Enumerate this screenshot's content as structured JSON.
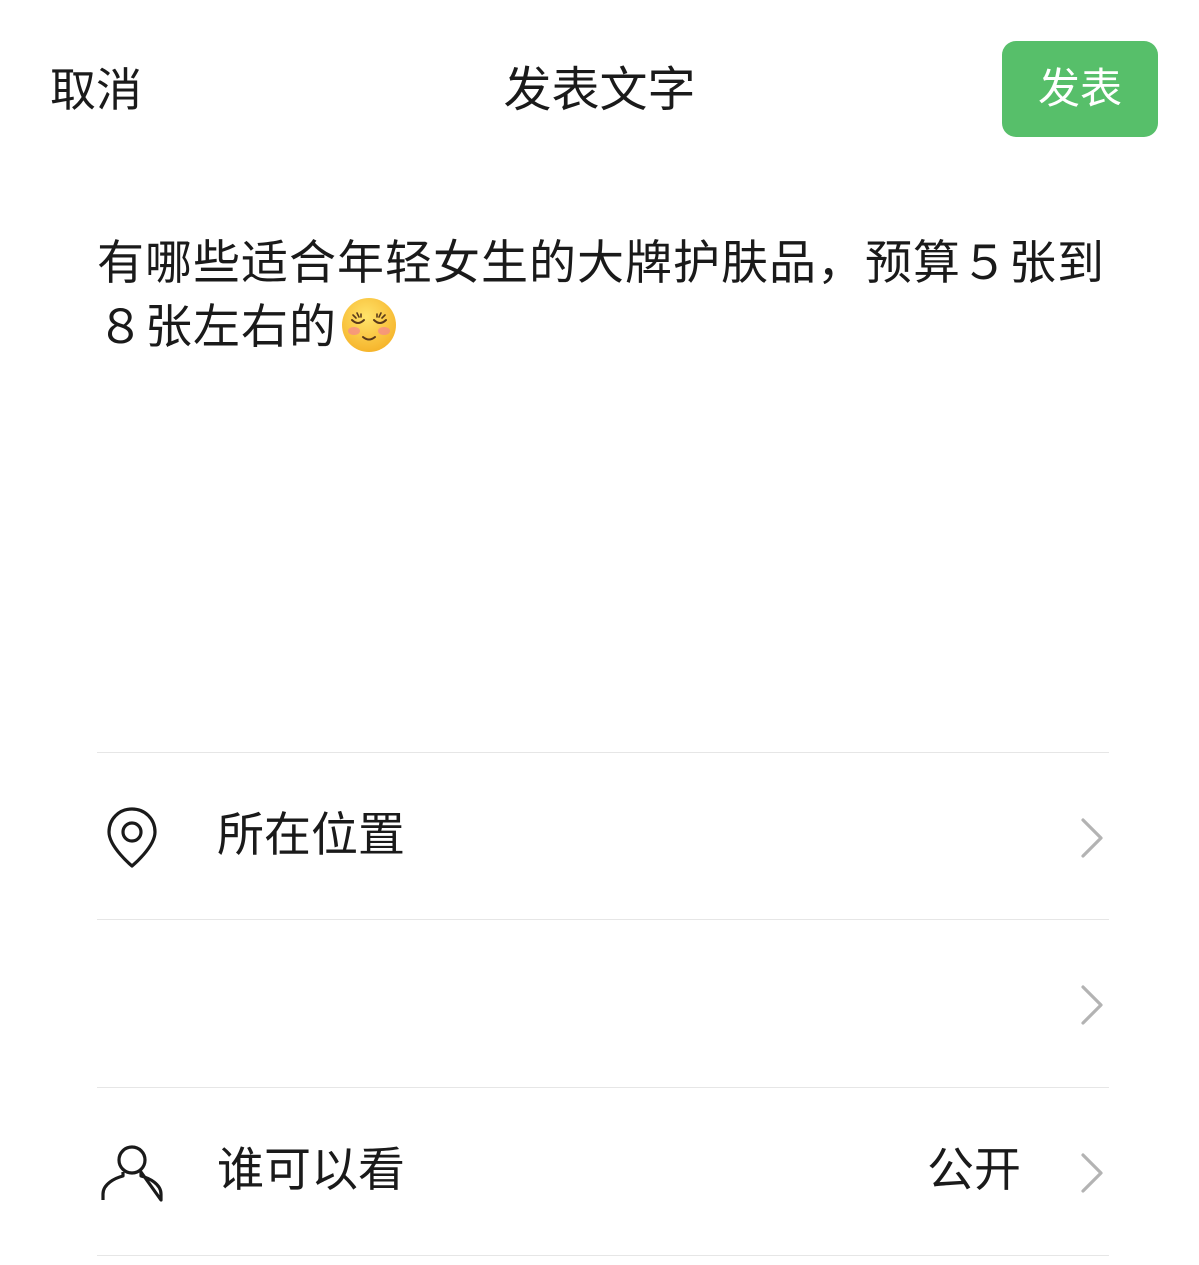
{
  "header": {
    "cancel_label": "取消",
    "title": "发表文字",
    "publish_label": "发表"
  },
  "composer": {
    "text": "有哪些适合年轻女生的大牌护肤品，预算５张到８张左右的",
    "emoji": "relieved-smiling-face-emoji"
  },
  "options": {
    "location": {
      "label": "所在位置",
      "icon": "location-pin-icon"
    },
    "empty_row": {
      "label": ""
    },
    "visibility": {
      "label": "谁可以看",
      "value": "公开",
      "icon": "person-icon"
    }
  },
  "colors": {
    "publish_button": "#57bf6a",
    "divider": "#e6e6e6",
    "chevron": "#b3b3b3",
    "text": "#1a1a1a"
  }
}
